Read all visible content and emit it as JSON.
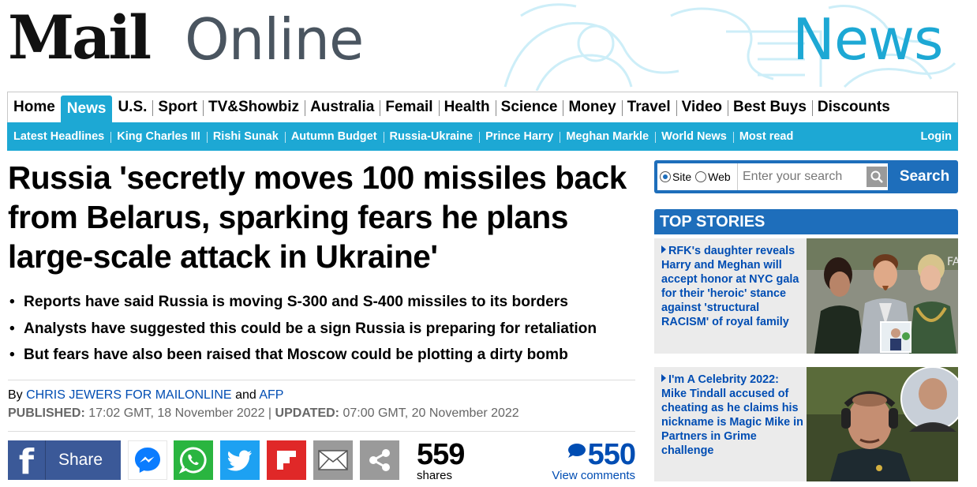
{
  "masthead": {
    "brand_bold": "Mail",
    "brand_light": "Online",
    "section": "News"
  },
  "primary_nav": [
    "Home",
    "News",
    "U.S.",
    "Sport",
    "TV&Showbiz",
    "Australia",
    "Femail",
    "Health",
    "Science",
    "Money",
    "Travel",
    "Video",
    "Best Buys",
    "Discounts"
  ],
  "primary_nav_active": "News",
  "secondary_nav": [
    "Latest Headlines",
    "King Charles III",
    "Rishi Sunak",
    "Autumn Budget",
    "Russia-Ukraine",
    "Prince Harry",
    "Meghan Markle",
    "World News",
    "Most read"
  ],
  "secondary_login": "Login",
  "article": {
    "headline": "Russia 'secretly moves 100 missiles back from Belarus, sparking fears he plans large-scale attack in Ukraine'",
    "bullets": [
      "Reports have said Russia is moving S-300 and S-400 missiles to its borders",
      "Analysts have suggested this could be a sign Russia is preparing for retaliation",
      "But fears have also been raised that Moscow could be plotting a dirty bomb"
    ],
    "byline_prefix": "By",
    "author": "CHRIS JEWERS FOR MAILONLINE",
    "byline_and": "and",
    "agency": "AFP",
    "published_label": "PUBLISHED:",
    "published": "17:02 GMT, 18 November 2022",
    "separator": "|",
    "updated_label": "UPDATED:",
    "updated": "07:00 GMT, 20 November 2022"
  },
  "share_bar": {
    "facebook_label": "Share",
    "share_count": "559",
    "share_label": "shares",
    "comment_count": "550",
    "comment_label": "View comments",
    "icons": [
      "facebook-icon",
      "messenger-icon",
      "whatsapp-icon",
      "twitter-icon",
      "flipboard-icon",
      "email-icon",
      "share-icon",
      "comment-bubble-icon"
    ]
  },
  "search": {
    "option_site": "Site",
    "option_web": "Web",
    "selected": "Site",
    "placeholder": "Enter your search",
    "button": "Search"
  },
  "top_stories": {
    "header": "TOP STORIES",
    "items": [
      {
        "text": "RFK's daughter reveals Harry and Meghan will accept honor at NYC gala for their 'heroic' stance against 'structural RACISM' of royal family"
      },
      {
        "text": "I'm A Celebrity 2022: Mike Tindall accused of cheating as he claims his nickname is Magic Mike in Partners in Grime challenge"
      }
    ]
  },
  "colors": {
    "brand_blue": "#1da8d4",
    "link_blue": "#004db3",
    "box_blue": "#1e6ebb",
    "facebook": "#3b5998",
    "whatsapp": "#2ab540",
    "twitter": "#1da1f2",
    "flipboard": "#e02828"
  }
}
